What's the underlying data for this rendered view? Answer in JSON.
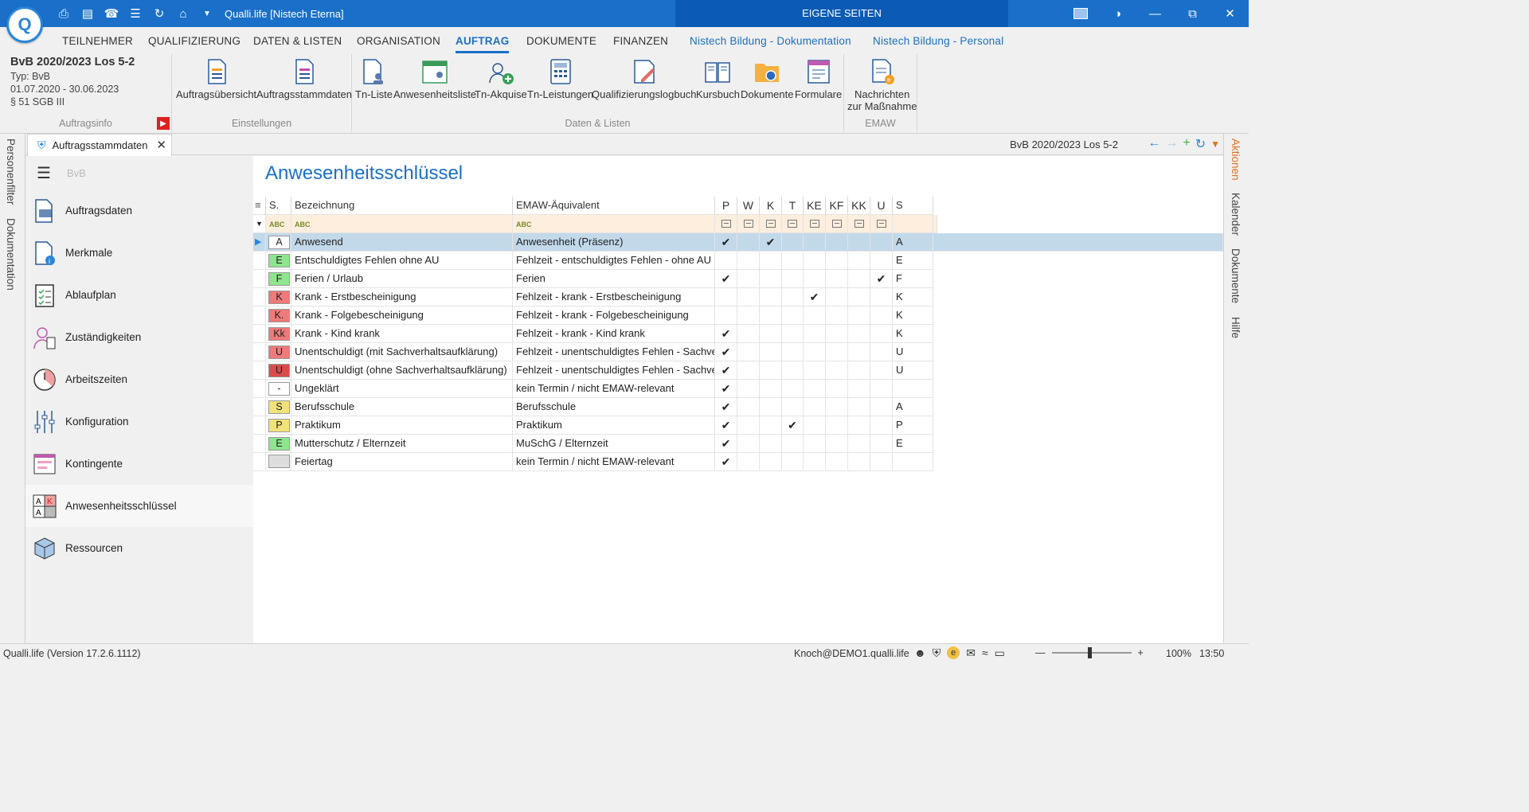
{
  "window": {
    "title": "Qualli.life [Nistech Eterna]",
    "eigene_seiten": "EIGENE SEITEN"
  },
  "menu": [
    "TEILNEHMER",
    "QUALIFIZIERUNG",
    "DATEN & LISTEN",
    "ORGANISATION",
    "AUFTRAG",
    "DOKUMENTE",
    "FINANZEN",
    "Nistech Bildung - Dokumentation",
    "Nistech Bildung - Personal"
  ],
  "menu_active": "AUFTRAG",
  "auftragsinfo": {
    "title": "BvB 2020/2023 Los 5-2",
    "typ": "Typ: BvB",
    "zeitraum": "01.07.2020 - 30.06.2023",
    "paragraph": "§ 51 SGB III",
    "group_label": "Auftragsinfo"
  },
  "ribbon": {
    "einstellungen": {
      "label": "Einstellungen",
      "buttons": [
        "Auftragsübersicht",
        "Auftragsstammdaten"
      ]
    },
    "daten": {
      "label": "Daten & Listen",
      "buttons": [
        "Tn-Liste",
        "Anwesenheitsliste",
        "Tn-Akquise",
        "Tn-Leistungen",
        "Qualifizierungslogbuch",
        "Kursbuch",
        "Dokumente",
        "Formulare"
      ]
    },
    "emaw": {
      "label": "EMAW",
      "button_line1": "Nachrichten",
      "button_line2": "zur Maßnahme"
    }
  },
  "left_tabs": [
    "Personenfilter",
    "Dokumentation"
  ],
  "right_tabs": [
    "Aktionen",
    "Kalender",
    "Dokumente",
    "Hilfe"
  ],
  "doc_tab": "Auftragsstammdaten",
  "breadcrumb": "BvB 2020/2023 Los 5-2",
  "sidenav": {
    "header": "BvB",
    "items": [
      "Auftragsdaten",
      "Merkmale",
      "Ablaufplan",
      "Zuständigkeiten",
      "Arbeitszeiten",
      "Konfiguration",
      "Kontingente",
      "Anwesenheitsschlüssel",
      "Ressourcen"
    ],
    "active": "Anwesenheitsschlüssel"
  },
  "page_title": "Anwesenheitsschlüssel",
  "table": {
    "columns": [
      "S.",
      "Bezeichnung",
      "EMAW-Äquivalent",
      "P",
      "W",
      "K",
      "T",
      "KE",
      "KF",
      "KK",
      "U",
      "S"
    ],
    "rows": [
      {
        "key": "A",
        "color": "#ffffff",
        "name": "Anwesend",
        "emaw": "Anwesenheit (Präsenz)",
        "flags": [
          "P",
          "K"
        ],
        "s": "A"
      },
      {
        "key": "E",
        "color": "#8ee58e",
        "name": "Entschuldigtes Fehlen ohne AU",
        "emaw": "Fehlzeit - entschuldigtes Fehlen - ohne AU",
        "flags": [],
        "s": "E"
      },
      {
        "key": "F",
        "color": "#8ee58e",
        "name": "Ferien / Urlaub",
        "emaw": "Ferien",
        "flags": [
          "P",
          "U"
        ],
        "s": "F"
      },
      {
        "key": "K",
        "color": "#ee7a7a",
        "name": "Krank - Erstbescheinigung",
        "emaw": "Fehlzeit - krank - Erstbescheinigung",
        "flags": [
          "KE"
        ],
        "s": "K"
      },
      {
        "key": "K.",
        "color": "#ee7a7a",
        "name": "Krank - Folgebescheinigung",
        "emaw": "Fehlzeit - krank - Folgebescheinigung",
        "flags": [],
        "s": "K"
      },
      {
        "key": "Kk",
        "color": "#ee7a7a",
        "name": "Krank - Kind krank",
        "emaw": "Fehlzeit - krank - Kind krank",
        "flags": [
          "P"
        ],
        "s": "K"
      },
      {
        "key": "U",
        "color": "#ee7a7a",
        "name": "Unentschuldigt (mit Sachverhaltsaufklärung)",
        "emaw": "Fehlzeit - unentschuldigtes Fehlen - Sachver...",
        "flags": [
          "P"
        ],
        "s": "U"
      },
      {
        "key": "U",
        "color": "#d94c4c",
        "name": "Unentschuldigt (ohne Sachverhaltsaufklärung)",
        "emaw": "Fehlzeit - unentschuldigtes Fehlen - Sachver...",
        "flags": [
          "P"
        ],
        "s": "U"
      },
      {
        "key": "-",
        "color": "#ffffff",
        "name": "Ungeklärt",
        "emaw": "kein Termin / nicht EMAW-relevant",
        "flags": [
          "P"
        ],
        "s": ""
      },
      {
        "key": "S",
        "color": "#f2e27a",
        "name": "Berufsschule",
        "emaw": "Berufsschule",
        "flags": [
          "P"
        ],
        "s": "A"
      },
      {
        "key": "P",
        "color": "#f2e27a",
        "name": "Praktikum",
        "emaw": "Praktikum",
        "flags": [
          "P",
          "T"
        ],
        "s": "P"
      },
      {
        "key": "E",
        "color": "#8ee58e",
        "name": "Mutterschutz / Elternzeit",
        "emaw": "MuSchG / Elternzeit",
        "flags": [
          "P"
        ],
        "s": "E"
      },
      {
        "key": "",
        "color": "#dddddd",
        "name": "Feiertag",
        "emaw": "kein Termin / nicht EMAW-relevant",
        "flags": [
          "P"
        ],
        "s": ""
      }
    ],
    "selected_row": 0
  },
  "status": {
    "version": "Qualli.life (Version 17.2.6.1112)",
    "user": "Knoch@DEMO1.qualli.life",
    "zoom": "100%",
    "time": "13:50"
  }
}
